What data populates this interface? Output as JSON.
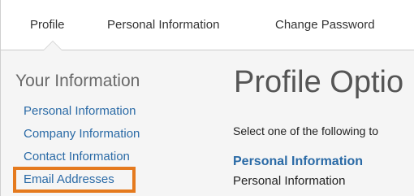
{
  "top_nav": {
    "tabs": [
      "Profile",
      "Personal Information",
      "Change Password"
    ],
    "active_tab": "Profile"
  },
  "sidebar": {
    "title": "Your Information",
    "links": [
      "Personal Information",
      "Company Information",
      "Contact Information",
      "Email Addresses"
    ],
    "highlighted_link": "Email Addresses",
    "highlight_color": "#e57a1e"
  },
  "main": {
    "title": "Profile Optio",
    "description": "Select one of the following to",
    "sections": [
      {
        "heading": "Personal Information",
        "text": "Personal Information"
      }
    ]
  }
}
